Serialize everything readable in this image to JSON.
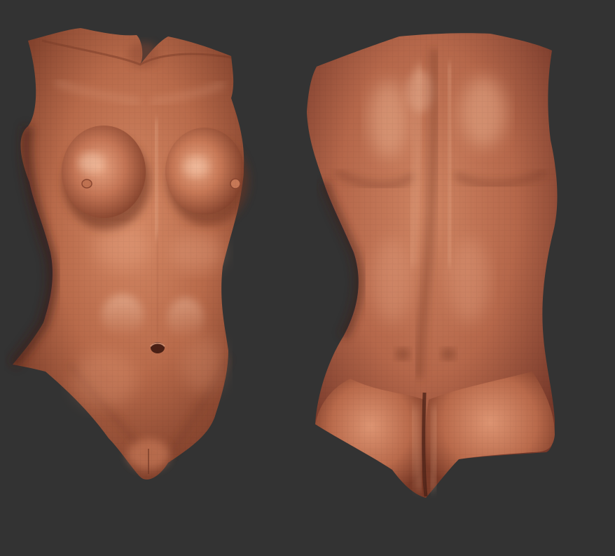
{
  "viewport": {
    "background": "#333333",
    "material": {
      "base": "#b86a4a",
      "light": "#e09a78",
      "highlight": "#f2c2a6",
      "shadow": "#6e3524",
      "deep_shadow": "#3d1c12"
    },
    "models": [
      {
        "view": "front"
      },
      {
        "view": "back"
      }
    ]
  }
}
